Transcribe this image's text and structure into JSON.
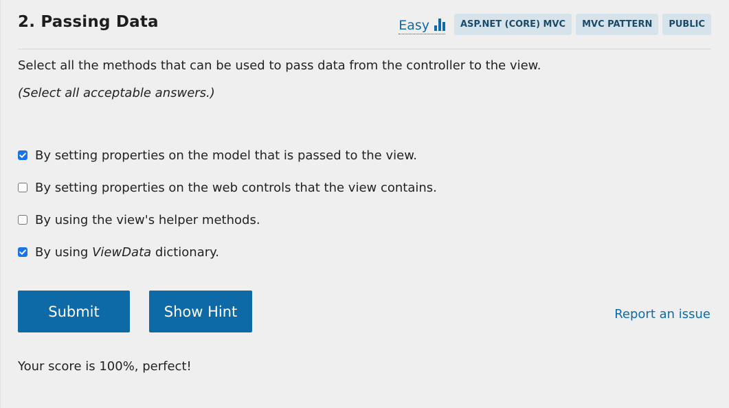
{
  "question": {
    "title": "2. Passing Data",
    "difficulty": "Easy",
    "difficulty_icon": "bar-chart-icon",
    "tags": [
      "ASP.NET (CORE) MVC",
      "MVC PATTERN",
      "PUBLIC"
    ],
    "prompt": "Select all the methods that can be used to pass data from the controller to the view.",
    "instruction": "(Select all acceptable answers.)"
  },
  "options": [
    {
      "text_before": "By setting properties on the model that is passed to the view.",
      "emphasis": "",
      "text_after": "",
      "checked": true
    },
    {
      "text_before": "By setting properties on the web controls that the view contains.",
      "emphasis": "",
      "text_after": "",
      "checked": false
    },
    {
      "text_before": "By using the view's helper methods.",
      "emphasis": "",
      "text_after": "",
      "checked": false
    },
    {
      "text_before": "By using ",
      "emphasis": "ViewData",
      "text_after": " dictionary.",
      "checked": true
    }
  ],
  "actions": {
    "submit_label": "Submit",
    "hint_label": "Show Hint",
    "report_label": "Report an issue"
  },
  "result": {
    "score_text": "Your score is 100%, perfect!"
  },
  "colors": {
    "accent": "#0e6aa6",
    "tag_bg": "#d7e3ea",
    "checkbox_checked": "#1a73e8",
    "background": "#efefef"
  }
}
